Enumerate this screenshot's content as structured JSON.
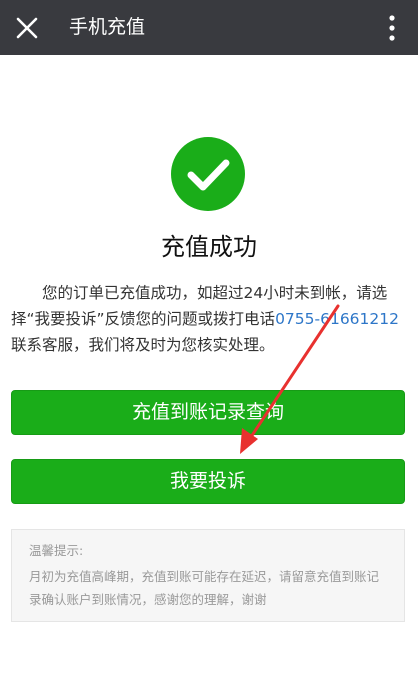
{
  "topbar": {
    "title": "手机充值",
    "close_icon": "close-icon",
    "more_icon": "more-vertical-icon"
  },
  "result": {
    "icon": "check-circle-icon",
    "title": "充值成功",
    "desc_before": "您的订单已充值成功，如超过24小时未到帐，请选择“我要投诉”反馈您的问题或拨打电话",
    "phone": "0755-61661212",
    "desc_after": "联系客服，我们将及时为您核实处理。"
  },
  "buttons": {
    "record": "充值到账记录查询",
    "complain": "我要投诉"
  },
  "tip": {
    "title": "温馨提示:",
    "text": "月初为充值高峰期，充值到账可能存在延迟，请留意充值到账记录确认账户到账情况，感谢您的理解，谢谢"
  },
  "colors": {
    "topbar_bg": "#393a3f",
    "accent_green": "#1aad19",
    "link_blue": "#2d76c8",
    "annotation_red": "#e8312f"
  }
}
